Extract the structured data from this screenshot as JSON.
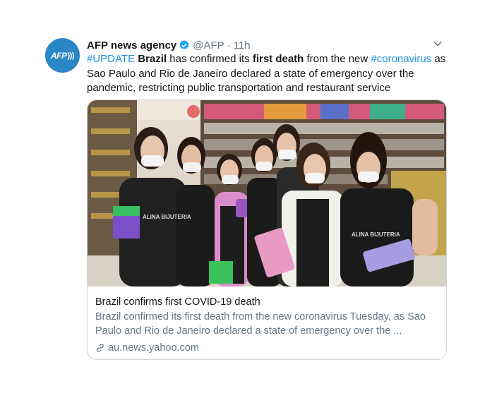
{
  "tweet": {
    "author_name": "AFP news agency",
    "author_handle": "@AFP",
    "separator": "·",
    "time": "11h",
    "avatar_text": "AFP",
    "text_parts": {
      "t1": "#UPDATE",
      "t2": " ",
      "t3": "Brazil",
      "t4": " has confirmed its ",
      "t5": "first death",
      "t6": " from the new ",
      "t7": "#coronavirus",
      "t8": " as Sao Paulo and Rio de Janeiro declared a state of emergency over the pandemic, restricting public transportation and restaurant service"
    }
  },
  "card": {
    "title": "Brazil confirms first COVID-19 death",
    "description": "Brazil confirmed its first death from the new coronavirus Tuesday, as Sao Paulo and Rio de Janeiro declared a state of emergency over the ...",
    "url": "au.news.yahoo.com",
    "apron_text_1": "ALINA BIJUTERIA",
    "apron_text_2": "ALINA BIJUTERIA"
  },
  "colors": {
    "link": "#1b95e0",
    "secondary": "#657786",
    "avatar": "#2b86c6"
  },
  "icons": [
    "verified-badge-icon",
    "chevron-down-icon",
    "link-icon"
  ]
}
